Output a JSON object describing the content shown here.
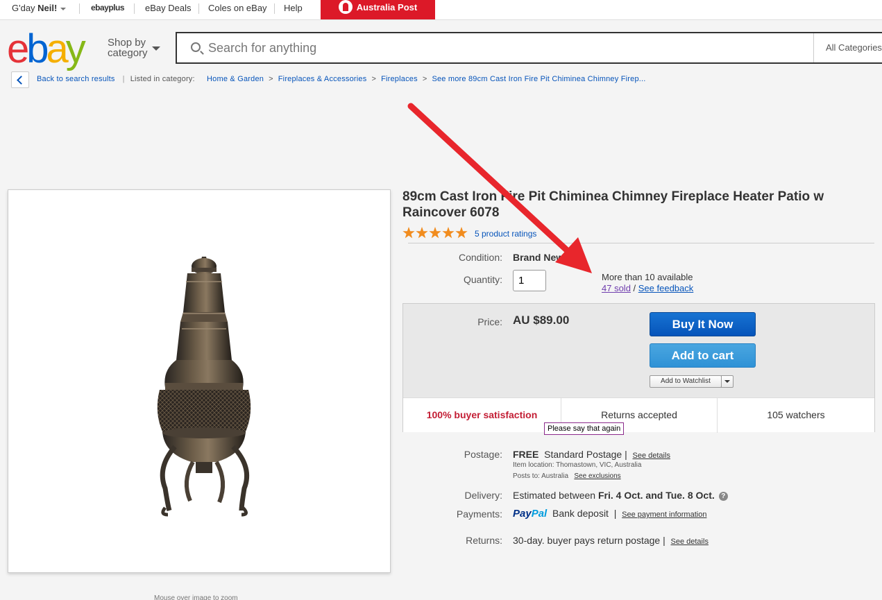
{
  "topbar": {
    "greeting_prefix": "G'day ",
    "user": "Neil!",
    "ebayplus_label": "ebayplus",
    "deals": "eBay Deals",
    "coles": "Coles on eBay",
    "help": "Help",
    "auspost": "Australia Post"
  },
  "header": {
    "shop_by_line1": "Shop by",
    "shop_by_line2": "category",
    "search_placeholder": "Search for anything",
    "category_select": "All Categories"
  },
  "breadcrumb": {
    "back": "Back to search results",
    "listed_in": "Listed in category:",
    "items": [
      "Home & Garden",
      "Fireplaces & Accessories",
      "Fireplaces",
      "See more 89cm Cast Iron Fire Pit Chiminea Chimney Firep..."
    ]
  },
  "image": {
    "caption": "Mouse over image to zoom"
  },
  "listing": {
    "title": "89cm Cast Iron Fire Pit Chiminea Chimney Fireplace Heater Patio w Raincover 6078",
    "rating_stars": 5,
    "ratings_link": "5 product ratings",
    "condition_label": "Condition:",
    "condition_value": "Brand New",
    "quantity_label": "Quantity:",
    "quantity_value": "1",
    "availability": "More than 10 available",
    "sold": "47 sold",
    "sold_sep": " / ",
    "feedback": "See feedback"
  },
  "pricebox": {
    "price_label": "Price:",
    "price": "AU $89.00",
    "buy_now": "Buy It Now",
    "add_to_cart": "Add to cart",
    "add_to_watchlist": "Add to Watchlist",
    "satisfaction": "100% buyer satisfaction",
    "returns": "Returns accepted",
    "watchers": "105 watchers"
  },
  "tooltip": "Please say that again",
  "shipping": {
    "postage_label": "Postage:",
    "postage_free": "FREE",
    "postage_type": "Standard Postage |",
    "postage_details": "See details",
    "item_location": "Item location:  Thomastown, VIC, Australia",
    "posts_to": "Posts to:  Australia",
    "see_exclusions": "See exclusions",
    "delivery_label": "Delivery:",
    "delivery_prefix": "Estimated between ",
    "delivery_dates": "Fri. 4 Oct. and Tue. 8 Oct.",
    "payments_label": "Payments:",
    "paypal_1": "Pay",
    "paypal_2": "Pal",
    "bank_deposit": "Bank deposit",
    "payment_info": "See payment information",
    "returns_label": "Returns:",
    "returns_value": "30-day. buyer pays return postage |",
    "returns_details": "See details"
  },
  "colors": {
    "brand_blue": "#0654ba",
    "star_orange": "#f18c1e",
    "satisfaction_red": "#c31d34",
    "annotation_arrow": "#e8262c",
    "auspost_red": "#dc1928"
  }
}
